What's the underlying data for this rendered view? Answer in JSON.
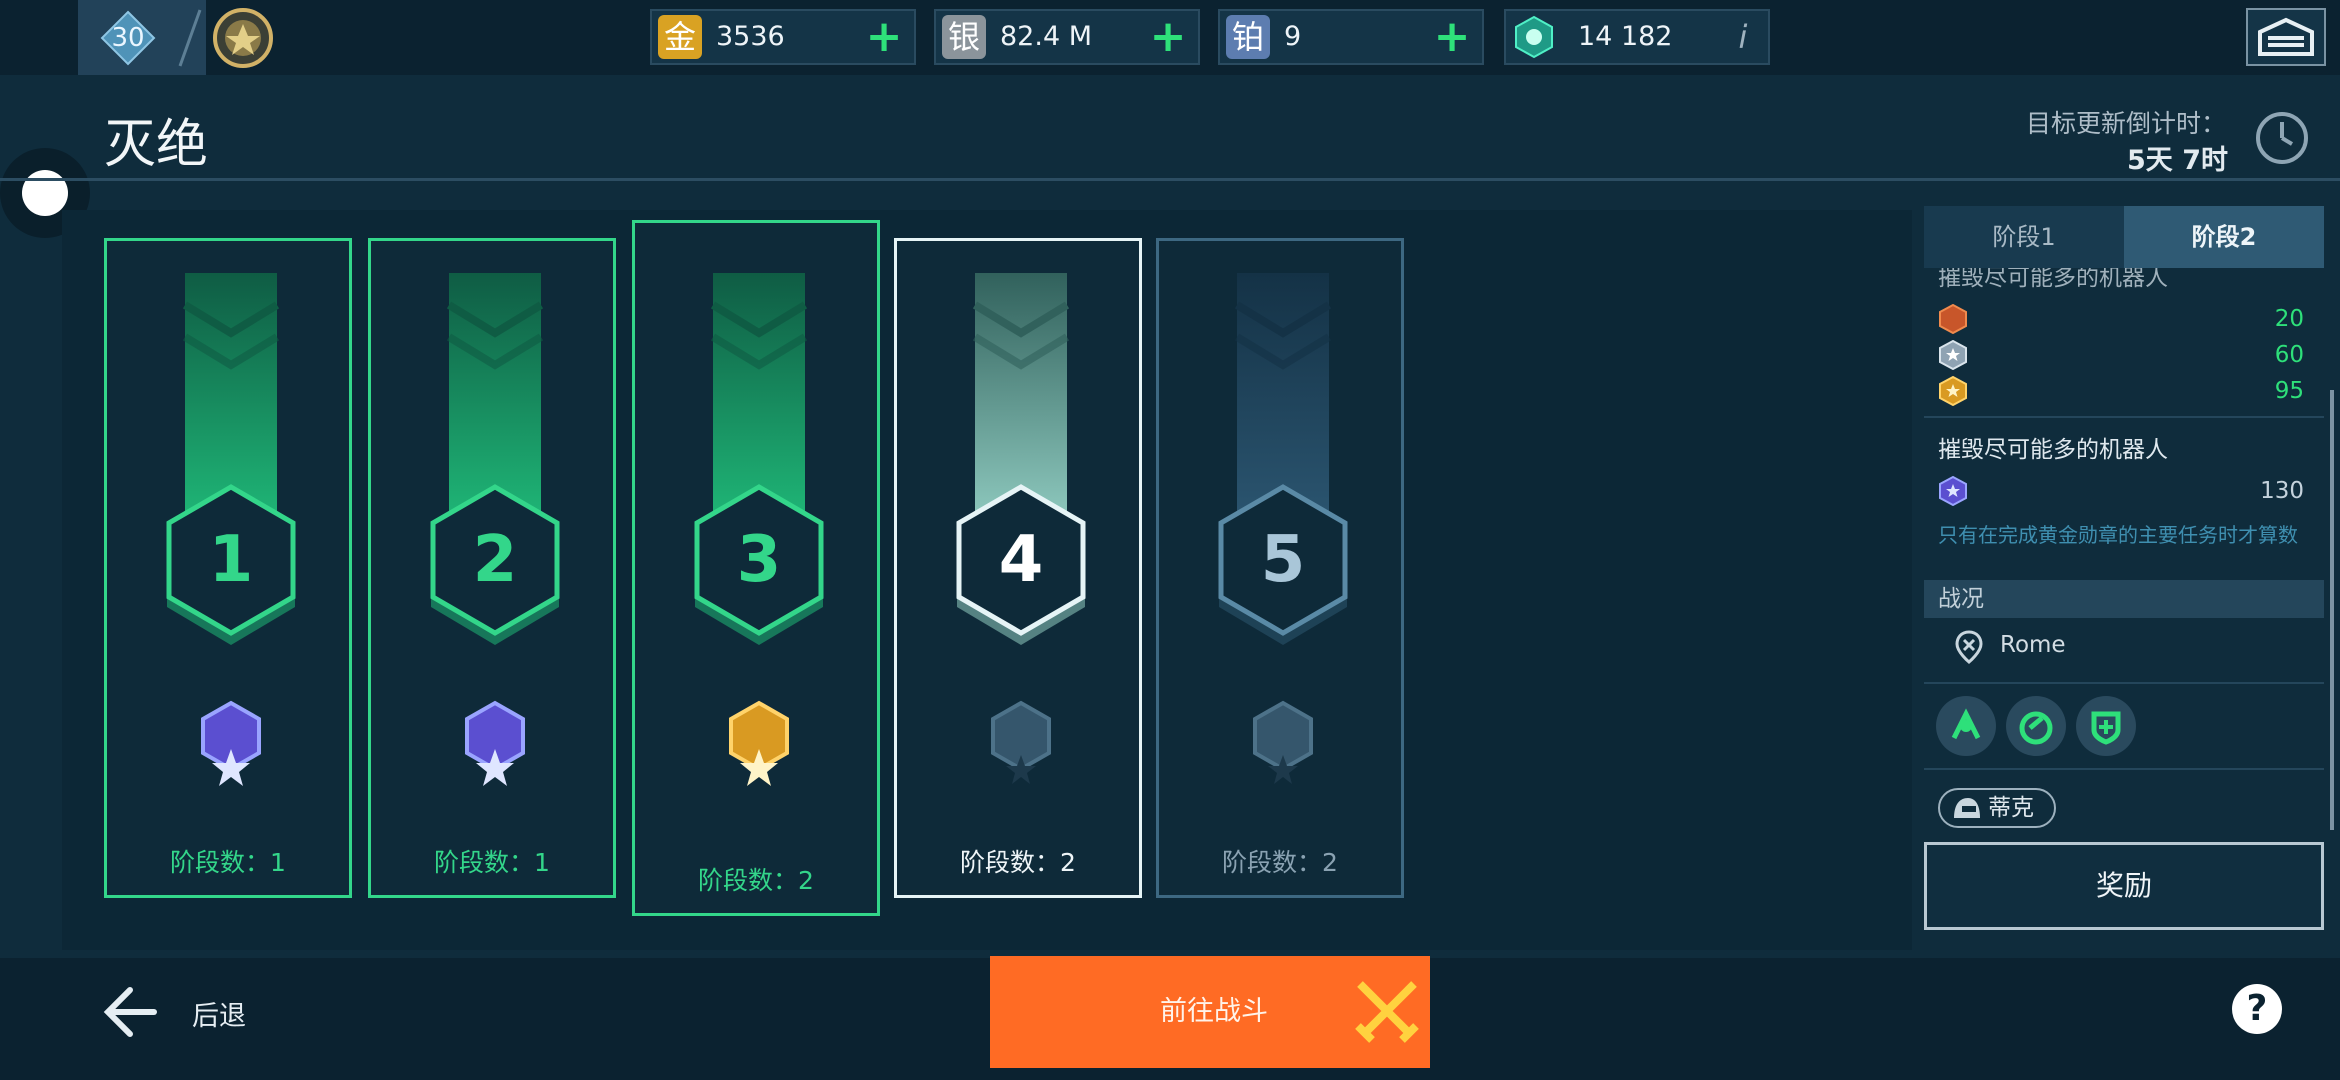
{
  "topbar": {
    "level": "30",
    "resources": [
      {
        "icon_char": "金",
        "value": "3536",
        "action": "plus",
        "icon": "gold-icon",
        "color": "#d9a223"
      },
      {
        "icon_char": "银",
        "value": "82.4 M",
        "action": "plus",
        "icon": "silver-icon",
        "color": "#8b949b"
      },
      {
        "icon_char": "铂",
        "value": "9",
        "action": "plus",
        "icon": "platinum-icon",
        "color": "#5d7db0"
      },
      {
        "icon_char": "",
        "value": "14 182",
        "action": "info",
        "icon": "key-token-icon",
        "color": "#27c39a"
      }
    ],
    "plus_symbol": "+",
    "info_symbol": "i"
  },
  "header": {
    "title": "灭绝",
    "countdown_label": "目标更新倒计时：",
    "countdown_value": "5天 7时"
  },
  "stages": [
    {
      "number": "1",
      "label": "阶段数：1",
      "state": "completed",
      "medal": "platinum"
    },
    {
      "number": "2",
      "label": "阶段数：1",
      "state": "completed",
      "medal": "platinum"
    },
    {
      "number": "3",
      "label": "阶段数：2",
      "state": "current",
      "medal": "gold"
    },
    {
      "number": "4",
      "label": "阶段数：2",
      "state": "next",
      "medal": "locked"
    },
    {
      "number": "5",
      "label": "阶段数：2",
      "state": "locked",
      "medal": "locked"
    }
  ],
  "panel": {
    "tabs": [
      "阶段1",
      "阶段2"
    ],
    "active_tab": 1,
    "cut_off_task": "摧毁尽可能多的机器人",
    "reward_rows": [
      {
        "medal": "bronze",
        "value": "20",
        "color": "#2ee07a"
      },
      {
        "medal": "silver",
        "value": "60",
        "color": "#2ee07a"
      },
      {
        "medal": "gold",
        "value": "95",
        "color": "#2ee07a"
      }
    ],
    "task_title": "摧毁尽可能多的机器人",
    "platinum_row": {
      "medal": "platinum",
      "value": "130",
      "color": "#c4d2dc"
    },
    "note": "只有在完成黄金勋章的主要任务时才算数",
    "battle_section": "战况",
    "location": "Rome",
    "modifiers": [
      "heal-boost-icon",
      "dash-boost-icon",
      "shield-repair-icon"
    ],
    "pilot": "蒂克",
    "reward_button": "奖励"
  },
  "bottombar": {
    "back_label": "后退",
    "battle_button": "前往战斗",
    "help": "?"
  },
  "colors": {
    "accent_green": "#33d68a",
    "battle_orange": "#ff6b24",
    "background": "#0f2c3c"
  }
}
